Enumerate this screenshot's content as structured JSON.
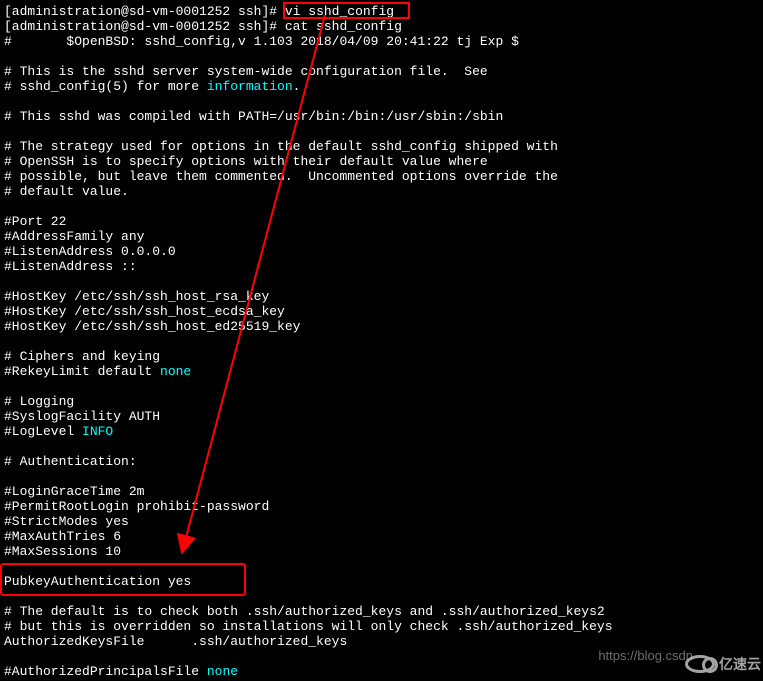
{
  "lines": [
    {
      "segments": [
        {
          "text": "[administration@sd-vm-0001252 ssh]# ",
          "cls": ""
        },
        {
          "text": "vi sshd_config",
          "cls": ""
        }
      ]
    },
    {
      "segments": [
        {
          "text": "[administration@sd-vm-0001252 ssh]# cat sshd_config",
          "cls": ""
        }
      ]
    },
    {
      "segments": [
        {
          "text": "#       $OpenBSD: sshd_config,v 1.103 2018/04/09 20:41:22 tj Exp $",
          "cls": ""
        }
      ]
    },
    {
      "segments": [
        {
          "text": " ",
          "cls": ""
        }
      ]
    },
    {
      "segments": [
        {
          "text": "# This is the sshd server system-wide configuration file.  See",
          "cls": ""
        }
      ]
    },
    {
      "segments": [
        {
          "text": "# sshd_config(5) for more ",
          "cls": ""
        },
        {
          "text": "information",
          "cls": "cyan"
        },
        {
          "text": ".",
          "cls": ""
        }
      ]
    },
    {
      "segments": [
        {
          "text": " ",
          "cls": ""
        }
      ]
    },
    {
      "segments": [
        {
          "text": "# This sshd was compiled with PATH=/usr/bin:/bin:/usr/sbin:/sbin",
          "cls": ""
        }
      ]
    },
    {
      "segments": [
        {
          "text": " ",
          "cls": ""
        }
      ]
    },
    {
      "segments": [
        {
          "text": "# The strategy used for options in the default sshd_config shipped with",
          "cls": ""
        }
      ]
    },
    {
      "segments": [
        {
          "text": "# OpenSSH is to specify options with their default value where",
          "cls": ""
        }
      ]
    },
    {
      "segments": [
        {
          "text": "# possible, but leave them commented.  Uncommented options override the",
          "cls": ""
        }
      ]
    },
    {
      "segments": [
        {
          "text": "# default value.",
          "cls": ""
        }
      ]
    },
    {
      "segments": [
        {
          "text": " ",
          "cls": ""
        }
      ]
    },
    {
      "segments": [
        {
          "text": "#Port 22",
          "cls": ""
        }
      ]
    },
    {
      "segments": [
        {
          "text": "#AddressFamily any",
          "cls": ""
        }
      ]
    },
    {
      "segments": [
        {
          "text": "#ListenAddress 0.0.0.0",
          "cls": ""
        }
      ]
    },
    {
      "segments": [
        {
          "text": "#ListenAddress ::",
          "cls": ""
        }
      ]
    },
    {
      "segments": [
        {
          "text": " ",
          "cls": ""
        }
      ]
    },
    {
      "segments": [
        {
          "text": "#HostKey /etc/ssh/ssh_host_rsa_key",
          "cls": ""
        }
      ]
    },
    {
      "segments": [
        {
          "text": "#HostKey /etc/ssh/ssh_host_ecdsa_key",
          "cls": ""
        }
      ]
    },
    {
      "segments": [
        {
          "text": "#HostKey /etc/ssh/ssh_host_ed25519_key",
          "cls": ""
        }
      ]
    },
    {
      "segments": [
        {
          "text": " ",
          "cls": ""
        }
      ]
    },
    {
      "segments": [
        {
          "text": "# Ciphers and keying",
          "cls": ""
        }
      ]
    },
    {
      "segments": [
        {
          "text": "#RekeyLimit default ",
          "cls": ""
        },
        {
          "text": "none",
          "cls": "cyan"
        }
      ]
    },
    {
      "segments": [
        {
          "text": " ",
          "cls": ""
        }
      ]
    },
    {
      "segments": [
        {
          "text": "# Logging",
          "cls": ""
        }
      ]
    },
    {
      "segments": [
        {
          "text": "#SyslogFacility AUTH",
          "cls": ""
        }
      ]
    },
    {
      "segments": [
        {
          "text": "#LogLevel ",
          "cls": ""
        },
        {
          "text": "INFO",
          "cls": "cyan"
        }
      ]
    },
    {
      "segments": [
        {
          "text": " ",
          "cls": ""
        }
      ]
    },
    {
      "segments": [
        {
          "text": "# Authentication:",
          "cls": ""
        }
      ]
    },
    {
      "segments": [
        {
          "text": " ",
          "cls": ""
        }
      ]
    },
    {
      "segments": [
        {
          "text": "#LoginGraceTime 2m",
          "cls": ""
        }
      ]
    },
    {
      "segments": [
        {
          "text": "#PermitRootLogin prohibit-password",
          "cls": ""
        }
      ]
    },
    {
      "segments": [
        {
          "text": "#StrictModes yes",
          "cls": ""
        }
      ]
    },
    {
      "segments": [
        {
          "text": "#MaxAuthTries 6",
          "cls": ""
        }
      ]
    },
    {
      "segments": [
        {
          "text": "#MaxSessions 10",
          "cls": ""
        }
      ]
    },
    {
      "segments": [
        {
          "text": " ",
          "cls": ""
        }
      ]
    },
    {
      "segments": [
        {
          "text": "PubkeyAuthentication yes",
          "cls": ""
        }
      ]
    },
    {
      "segments": [
        {
          "text": " ",
          "cls": ""
        }
      ]
    },
    {
      "segments": [
        {
          "text": "# The default is to check both .ssh/authorized_keys and .ssh/authorized_keys2",
          "cls": ""
        }
      ]
    },
    {
      "segments": [
        {
          "text": "# but this is overridden so installations will only check .ssh/authorized_keys",
          "cls": ""
        }
      ]
    },
    {
      "segments": [
        {
          "text": "AuthorizedKeysFile      .ssh/authorized_keys",
          "cls": ""
        }
      ]
    },
    {
      "segments": [
        {
          "text": " ",
          "cls": ""
        }
      ]
    },
    {
      "segments": [
        {
          "text": "#AuthorizedPrincipalsFile ",
          "cls": ""
        },
        {
          "text": "none",
          "cls": "cyan"
        }
      ]
    }
  ],
  "watermark": {
    "text": "https://blog.csdn",
    "logo": "亿速云"
  }
}
